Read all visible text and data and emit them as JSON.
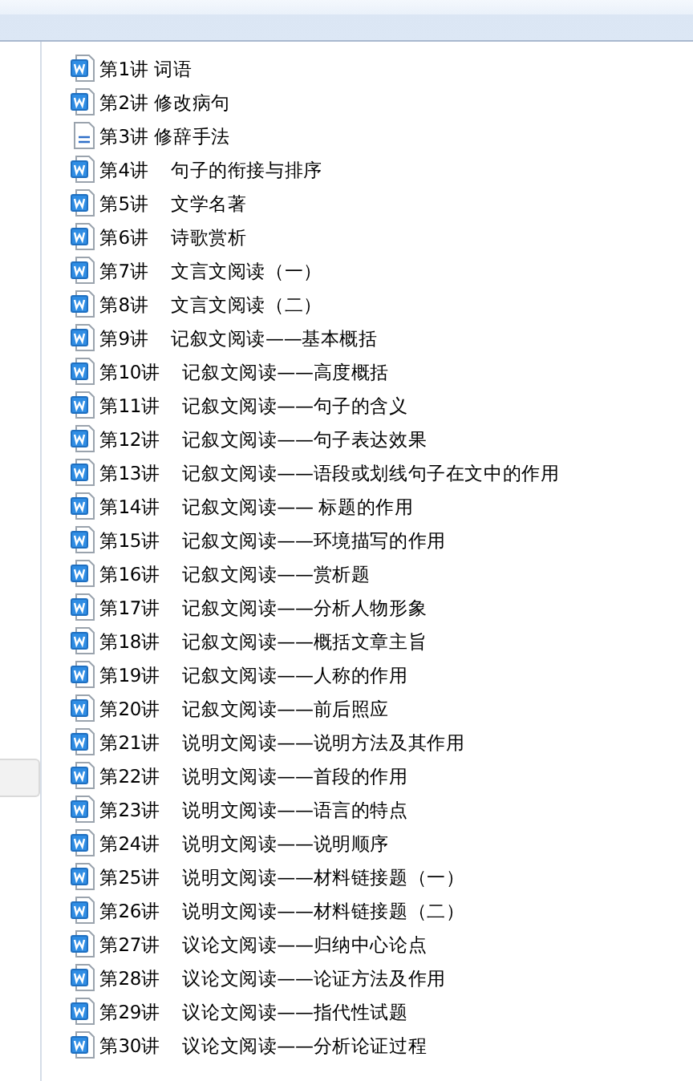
{
  "files": [
    {
      "name": "第1讲 词语",
      "kind": "word"
    },
    {
      "name": "第2讲 修改病句",
      "kind": "word"
    },
    {
      "name": "第3讲 修辞手法",
      "kind": "text"
    },
    {
      "name": "第4讲    句子的衔接与排序",
      "kind": "word"
    },
    {
      "name": "第5讲    文学名著",
      "kind": "word"
    },
    {
      "name": "第6讲    诗歌赏析",
      "kind": "word"
    },
    {
      "name": "第7讲    文言文阅读（一）",
      "kind": "word"
    },
    {
      "name": "第8讲    文言文阅读（二）",
      "kind": "word"
    },
    {
      "name": "第9讲    记叙文阅读——基本概括",
      "kind": "word"
    },
    {
      "name": "第10讲    记叙文阅读——高度概括",
      "kind": "word"
    },
    {
      "name": "第11讲    记叙文阅读——句子的含义",
      "kind": "word"
    },
    {
      "name": "第12讲    记叙文阅读——句子表达效果",
      "kind": "word"
    },
    {
      "name": "第13讲    记叙文阅读——语段或划线句子在文中的作用",
      "kind": "word"
    },
    {
      "name": "第14讲    记叙文阅读—— 标题的作用",
      "kind": "word"
    },
    {
      "name": "第15讲    记叙文阅读——环境描写的作用",
      "kind": "word"
    },
    {
      "name": "第16讲    记叙文阅读——赏析题",
      "kind": "word"
    },
    {
      "name": "第17讲    记叙文阅读——分析人物形象",
      "kind": "word"
    },
    {
      "name": "第18讲    记叙文阅读——概括文章主旨",
      "kind": "word"
    },
    {
      "name": "第19讲    记叙文阅读——人称的作用",
      "kind": "word"
    },
    {
      "name": "第20讲    记叙文阅读——前后照应",
      "kind": "word"
    },
    {
      "name": "第21讲    说明文阅读——说明方法及其作用",
      "kind": "word"
    },
    {
      "name": "第22讲    说明文阅读——首段的作用",
      "kind": "word"
    },
    {
      "name": "第23讲    说明文阅读——语言的特点",
      "kind": "word"
    },
    {
      "name": "第24讲    说明文阅读——说明顺序",
      "kind": "word"
    },
    {
      "name": "第25讲    说明文阅读——材料链接题（一）",
      "kind": "word"
    },
    {
      "name": "第26讲    说明文阅读——材料链接题（二）",
      "kind": "word"
    },
    {
      "name": "第27讲    议论文阅读——归纳中心论点",
      "kind": "word"
    },
    {
      "name": "第28讲    议论文阅读——论证方法及作用",
      "kind": "word"
    },
    {
      "name": "第29讲    议论文阅读——指代性试题",
      "kind": "word"
    },
    {
      "name": "第30讲    议论文阅读——分析论证过程",
      "kind": "word"
    }
  ]
}
